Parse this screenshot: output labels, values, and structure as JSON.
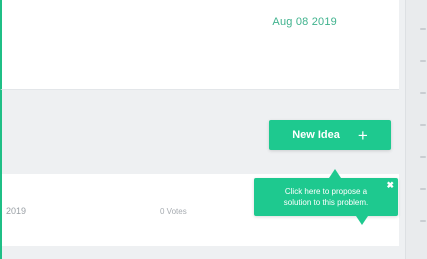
{
  "card_top": {
    "date": "Aug 08 2019"
  },
  "action": {
    "new_idea_label": "New Idea",
    "new_idea_icon": "plus-icon",
    "new_idea_glyph": "+"
  },
  "row": {
    "date_partial": "2019",
    "votes": "0 Votes"
  },
  "tooltip": {
    "text": "Click here to propose a solution to this problem.",
    "close_icon": "close-icon",
    "close_glyph": "✖"
  },
  "colors": {
    "accent": "#1ec98f",
    "date_green": "#3fb28d",
    "border_green": "#1fbf86"
  }
}
